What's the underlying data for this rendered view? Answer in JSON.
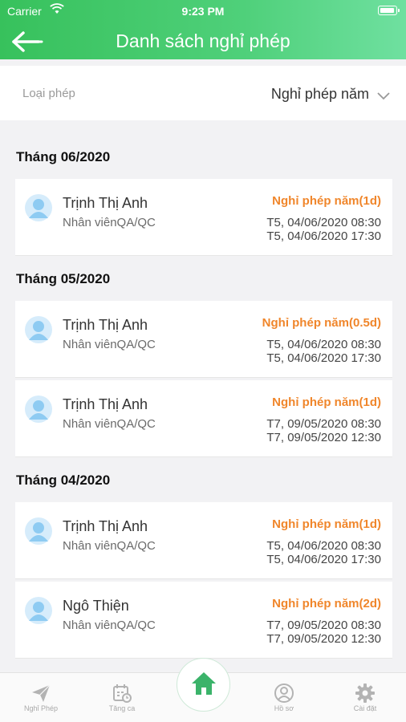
{
  "status": {
    "carrier": "Carrier",
    "time": "9:23 PM"
  },
  "header": {
    "title": "Danh sách nghỉ phép"
  },
  "filter": {
    "label": "Loại phép",
    "value": "Nghỉ phép năm"
  },
  "months": [
    {
      "label": "Tháng 06/2020",
      "items": [
        {
          "name": "Trịnh Thị Anh",
          "role": "Nhân viênQA/QC",
          "type": "Nghỉ phép năm(1d)",
          "start": "T5, 04/06/2020 08:30",
          "end": "T5, 04/06/2020 17:30"
        }
      ]
    },
    {
      "label": "Tháng 05/2020",
      "items": [
        {
          "name": "Trịnh Thị Anh",
          "role": "Nhân viênQA/QC",
          "type": "Nghỉ phép năm(0.5d)",
          "start": "T5, 04/06/2020 08:30",
          "end": "T5, 04/06/2020 17:30"
        },
        {
          "name": "Trịnh Thị Anh",
          "role": "Nhân viênQA/QC",
          "type": "Nghỉ phép năm(1d)",
          "start": "T7, 09/05/2020 08:30",
          "end": "T7, 09/05/2020 12:30"
        }
      ]
    },
    {
      "label": "Tháng 04/2020",
      "items": [
        {
          "name": "Trịnh Thị Anh",
          "role": "Nhân viênQA/QC",
          "type": "Nghỉ phép năm(1d)",
          "start": "T5, 04/06/2020 08:30",
          "end": "T5, 04/06/2020 17:30"
        },
        {
          "name": "Ngô Thiện",
          "role": "Nhân viênQA/QC",
          "type": "Nghỉ phép năm(2d)",
          "start": "T7, 09/05/2020 08:30",
          "end": "T7, 09/05/2020 12:30"
        }
      ]
    }
  ],
  "tabs": [
    {
      "label": "Nghỉ Phép",
      "icon": "paper-plane-icon"
    },
    {
      "label": "Tăng ca",
      "icon": "calendar-clock-icon"
    },
    {
      "label": "",
      "icon": "home-icon"
    },
    {
      "label": "Hồ sơ",
      "icon": "profile-icon"
    },
    {
      "label": "Cài đặt",
      "icon": "gear-icon"
    }
  ],
  "colors": {
    "header": "#3fc866",
    "accent_orange": "#f0862b",
    "home_green": "#3bb36a"
  }
}
